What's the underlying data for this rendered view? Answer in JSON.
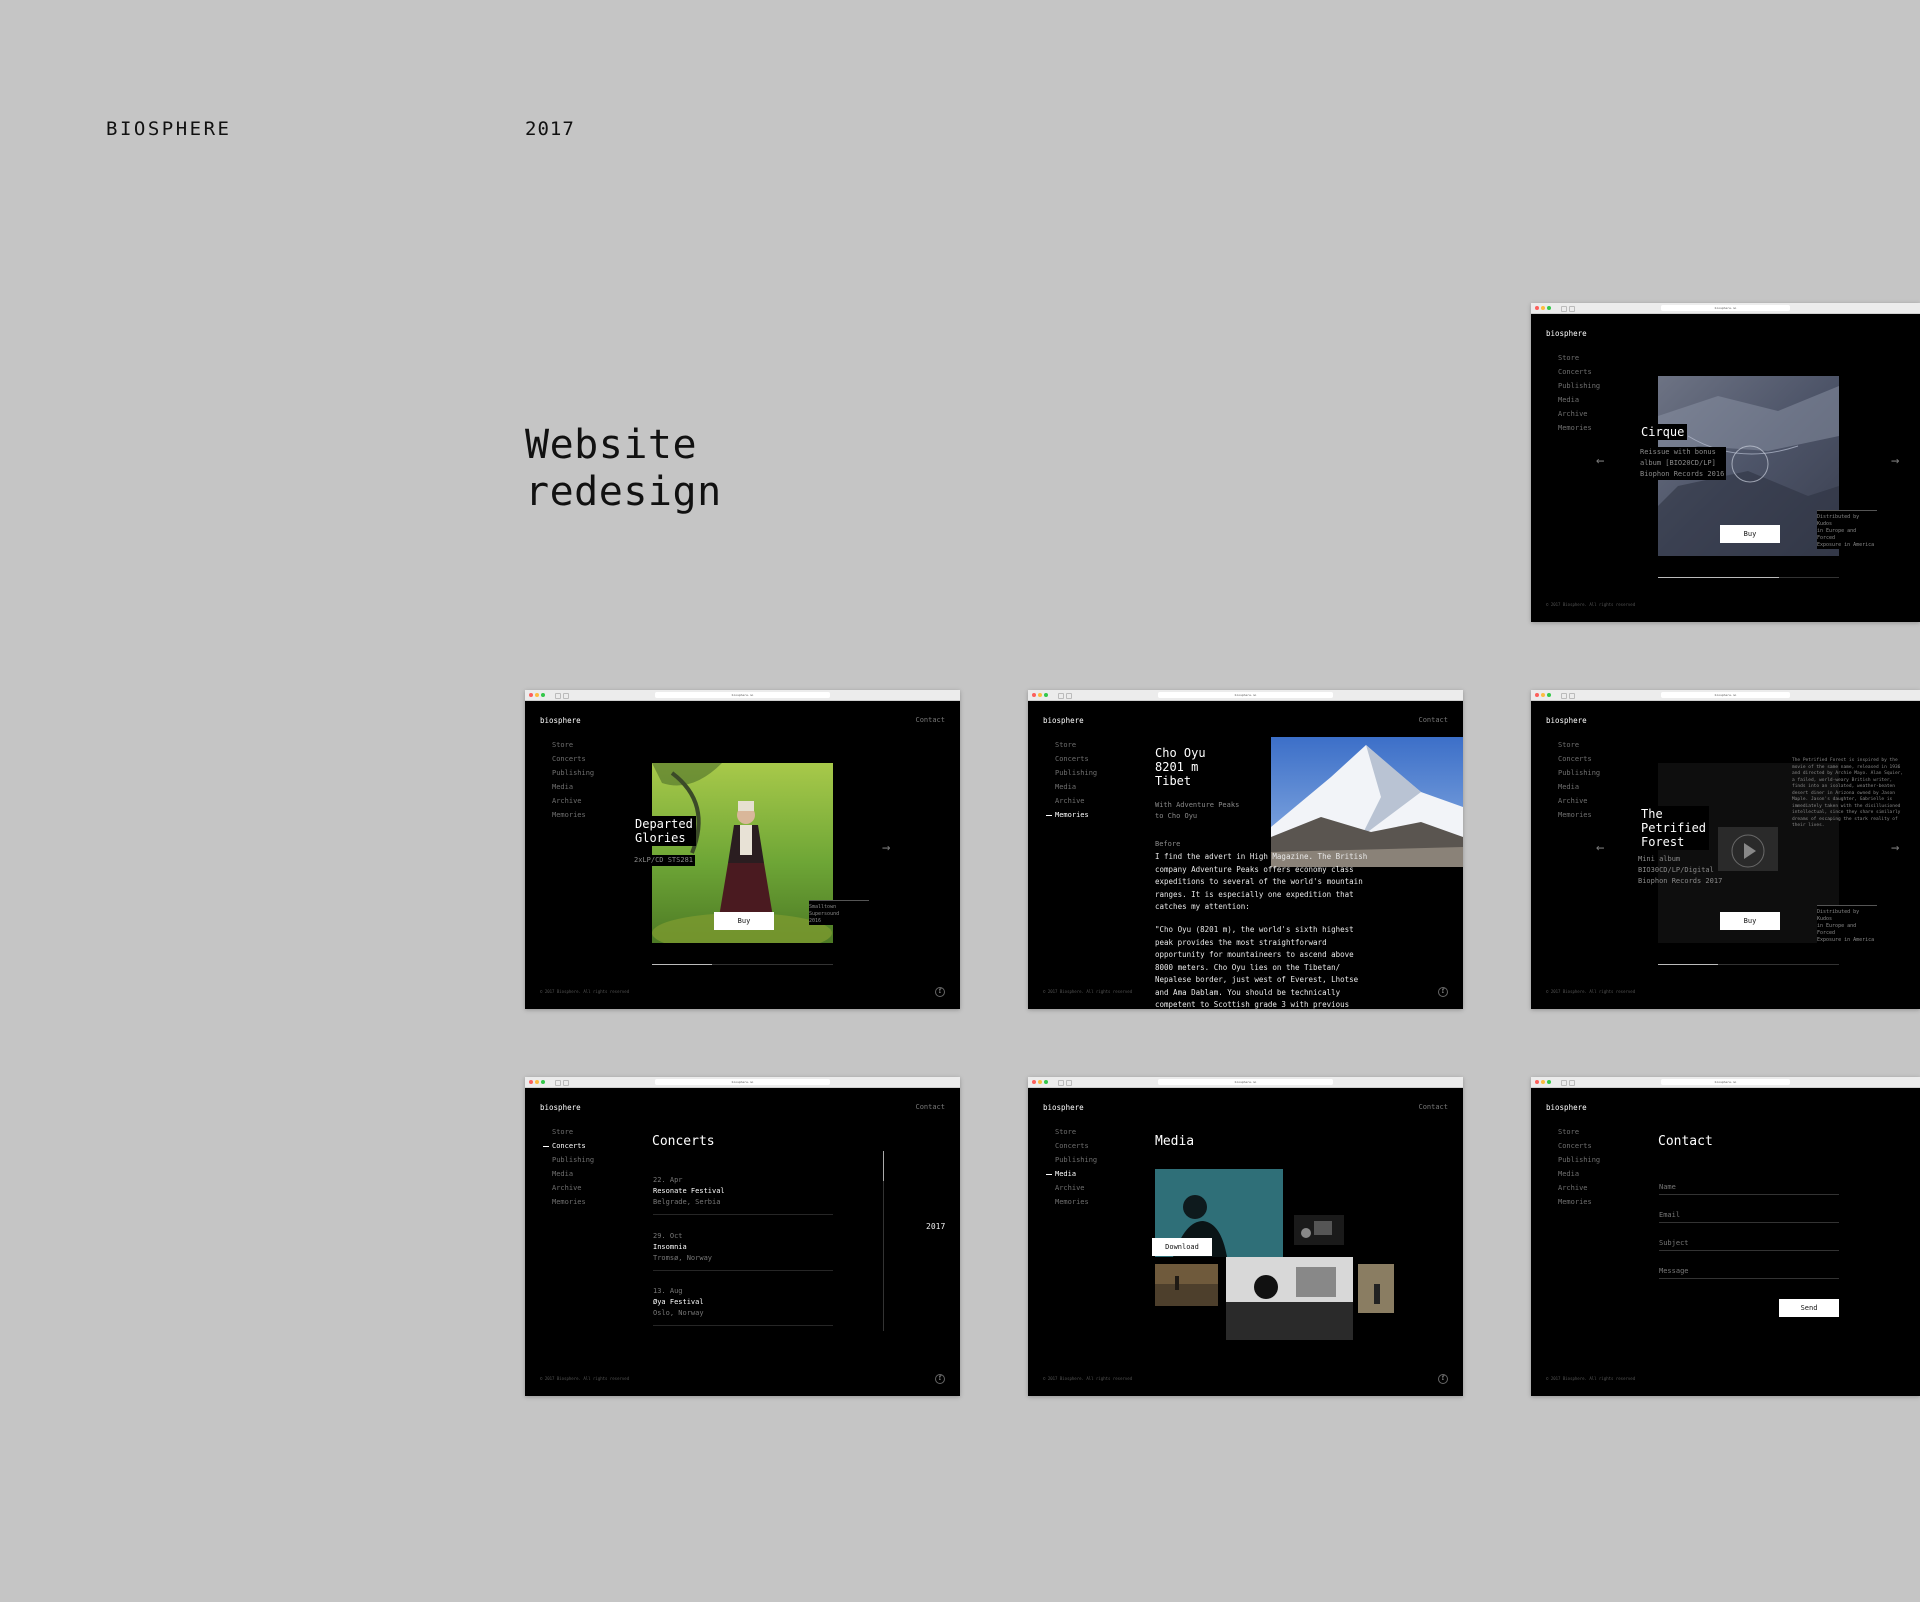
{
  "header": {
    "brand": "BIOSPHERE",
    "year": "2017"
  },
  "headline": {
    "line1": "Website",
    "line2": "redesign"
  },
  "common": {
    "logo": "biosphere",
    "contact": "Contact",
    "url": "biosphere.no",
    "footer": "© 2017 Biosphere. All rights reserved",
    "fb": "f",
    "arrow_left": "←",
    "arrow_right": "→",
    "nav": [
      "Store",
      "Concerts",
      "Publishing",
      "Media",
      "Archive",
      "Memories"
    ]
  },
  "cirque": {
    "title": "Cirque",
    "meta": [
      "Reissue with bonus",
      "album [BIO20CD/LP]",
      "Biophon Records 2016"
    ],
    "dist": [
      "Distributed by Kudos",
      "in Europe and Forced",
      "Exposure in America"
    ],
    "buy": "Buy",
    "progress": 0.67
  },
  "departed": {
    "title_line1": "Departed",
    "title_line2": "Glories",
    "format": "2xLP/CD STS281",
    "dist": [
      "Smalltown Supersound",
      "2016"
    ],
    "buy": "Buy",
    "progress": 0.33
  },
  "memories": {
    "title": [
      "Cho Oyu",
      "8201 m",
      "Tibet"
    ],
    "subtitle": [
      "With Adventure Peaks",
      "to Cho Oyu"
    ],
    "before": "Before",
    "body1": [
      "I find the advert in High Magazine. The British",
      "company Adventure Peaks offers economy class",
      "expeditions to several of the world's mountain",
      "ranges. It is especially one expedition that",
      "catches my attention:"
    ],
    "body2": [
      "\"Cho Oyu (8201 m), the world's sixth highest",
      "peak provides the most straightforward",
      "opportunity for mountaineers to ascend above",
      "8000 meters. Cho Oyu lies on the Tibetan/",
      "Nepalese border, just west of Everest, Lhotse",
      "and Ama Dablam. You should be technically",
      "competent to Scottish grade 3 with previous"
    ]
  },
  "petrified": {
    "title": [
      "The",
      "Petrified",
      "Forest"
    ],
    "meta": [
      "Mini album",
      "BIO30CD/LP/Digital",
      "Biophon Records 2017"
    ],
    "description": [
      "The Petrified Forest is inspired by the",
      "movie of the same name, released in 1936",
      "and directed by Archie Mayo. Alan Squier,",
      "a failed, world-weary British writer,",
      "finds into an isolated, weather-beaten",
      "desert diner in Arizona owned by Jason",
      "Maple. Jason's daughter, Gabrielle is",
      "immediately taken with the disillusioned",
      "intellectual, since they share similarly",
      "dreams of escaping the stark reality of",
      "their lives."
    ],
    "dist": [
      "Distributed by Kudos",
      "in Europe and Forced",
      "Exposure in America"
    ],
    "buy": "Buy",
    "progress": 0.33
  },
  "concerts": {
    "heading": "Concerts",
    "year": "2017",
    "items": [
      {
        "date": "22. Apr",
        "name": "Resonate Festival",
        "place": "Belgrade, Serbia"
      },
      {
        "date": "29. Oct",
        "name": "Insomnia",
        "place": "Tromsø, Norway"
      },
      {
        "date": "13. Aug",
        "name": "Øya Festival",
        "place": "Oslo, Norway"
      }
    ]
  },
  "media": {
    "heading": "Media",
    "download": "Download"
  },
  "contact_page": {
    "heading": "Contact",
    "fields": [
      "Name",
      "Email",
      "Subject",
      "Message"
    ],
    "send": "Send"
  }
}
